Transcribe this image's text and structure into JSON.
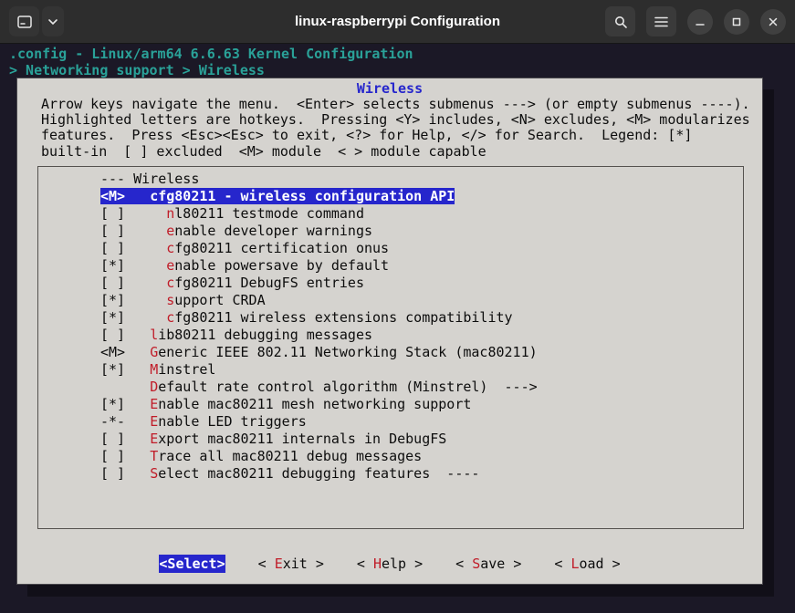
{
  "window": {
    "title": "linux-raspberrypi Configuration"
  },
  "terminal": {
    "config_line": ".config - Linux/arm64 6.6.63 Kernel Configuration",
    "breadcrumb": "> Networking support > Wireless"
  },
  "dialog": {
    "title": "Wireless",
    "instructions": [
      "Arrow keys navigate the menu.  <Enter> selects submenus ---> (or empty submenus ----).",
      "Highlighted letters are hotkeys.  Pressing <Y> includes, <N> excludes, <M> modularizes",
      "features.  Press <Esc><Esc> to exit, <?> for Help, </> for Search.  Legend: [*]",
      "built-in  [ ] excluded  <M> module  < > module capable"
    ],
    "menu_items": [
      {
        "pre": "--- Wireless",
        "key": "",
        "post": "",
        "selected": false
      },
      {
        "pre": "<M>   ",
        "key": "c",
        "post": "fg80211 - wireless configuration API",
        "selected": true
      },
      {
        "pre": "[ ]     ",
        "key": "n",
        "post": "l80211 testmode command",
        "selected": false
      },
      {
        "pre": "[ ]     ",
        "key": "e",
        "post": "nable developer warnings",
        "selected": false
      },
      {
        "pre": "[ ]     ",
        "key": "c",
        "post": "fg80211 certification onus",
        "selected": false
      },
      {
        "pre": "[*]     ",
        "key": "e",
        "post": "nable powersave by default",
        "selected": false
      },
      {
        "pre": "[ ]     ",
        "key": "c",
        "post": "fg80211 DebugFS entries",
        "selected": false
      },
      {
        "pre": "[*]     ",
        "key": "s",
        "post": "upport CRDA",
        "selected": false
      },
      {
        "pre": "[*]     ",
        "key": "c",
        "post": "fg80211 wireless extensions compatibility",
        "selected": false
      },
      {
        "pre": "[ ]   ",
        "key": "l",
        "post": "ib80211 debugging messages",
        "selected": false
      },
      {
        "pre": "<M>   ",
        "key": "G",
        "post": "eneric IEEE 802.11 Networking Stack (mac80211)",
        "selected": false
      },
      {
        "pre": "[*]   ",
        "key": "M",
        "post": "instrel",
        "selected": false
      },
      {
        "pre": "      ",
        "key": "D",
        "post": "efault rate control algorithm (Minstrel)  --->",
        "selected": false
      },
      {
        "pre": "[*]   ",
        "key": "E",
        "post": "nable mac80211 mesh networking support",
        "selected": false
      },
      {
        "pre": "-*-   ",
        "key": "E",
        "post": "nable LED triggers",
        "selected": false
      },
      {
        "pre": "[ ]   ",
        "key": "E",
        "post": "xport mac80211 internals in DebugFS",
        "selected": false
      },
      {
        "pre": "[ ]   ",
        "key": "T",
        "post": "race all mac80211 debug messages",
        "selected": false
      },
      {
        "pre": "[ ]   ",
        "key": "S",
        "post": "elect mac80211 debugging features  ----",
        "selected": false
      }
    ],
    "buttons": [
      {
        "pre": "<",
        "key": "S",
        "post": "elect>",
        "selected": true
      },
      {
        "pre": "< ",
        "key": "E",
        "post": "xit >",
        "selected": false
      },
      {
        "pre": "< ",
        "key": "H",
        "post": "elp >",
        "selected": false
      },
      {
        "pre": "< ",
        "key": "S",
        "post": "ave >",
        "selected": false
      },
      {
        "pre": "< ",
        "key": "L",
        "post": "oad >",
        "selected": false
      }
    ]
  },
  "colors": {
    "accent_blue": "#2626cc",
    "hotkey_red": "#c01c28",
    "header_teal": "#2aa198",
    "dialog_bg": "#d5d3cf",
    "terminal_bg": "#1b1826"
  }
}
